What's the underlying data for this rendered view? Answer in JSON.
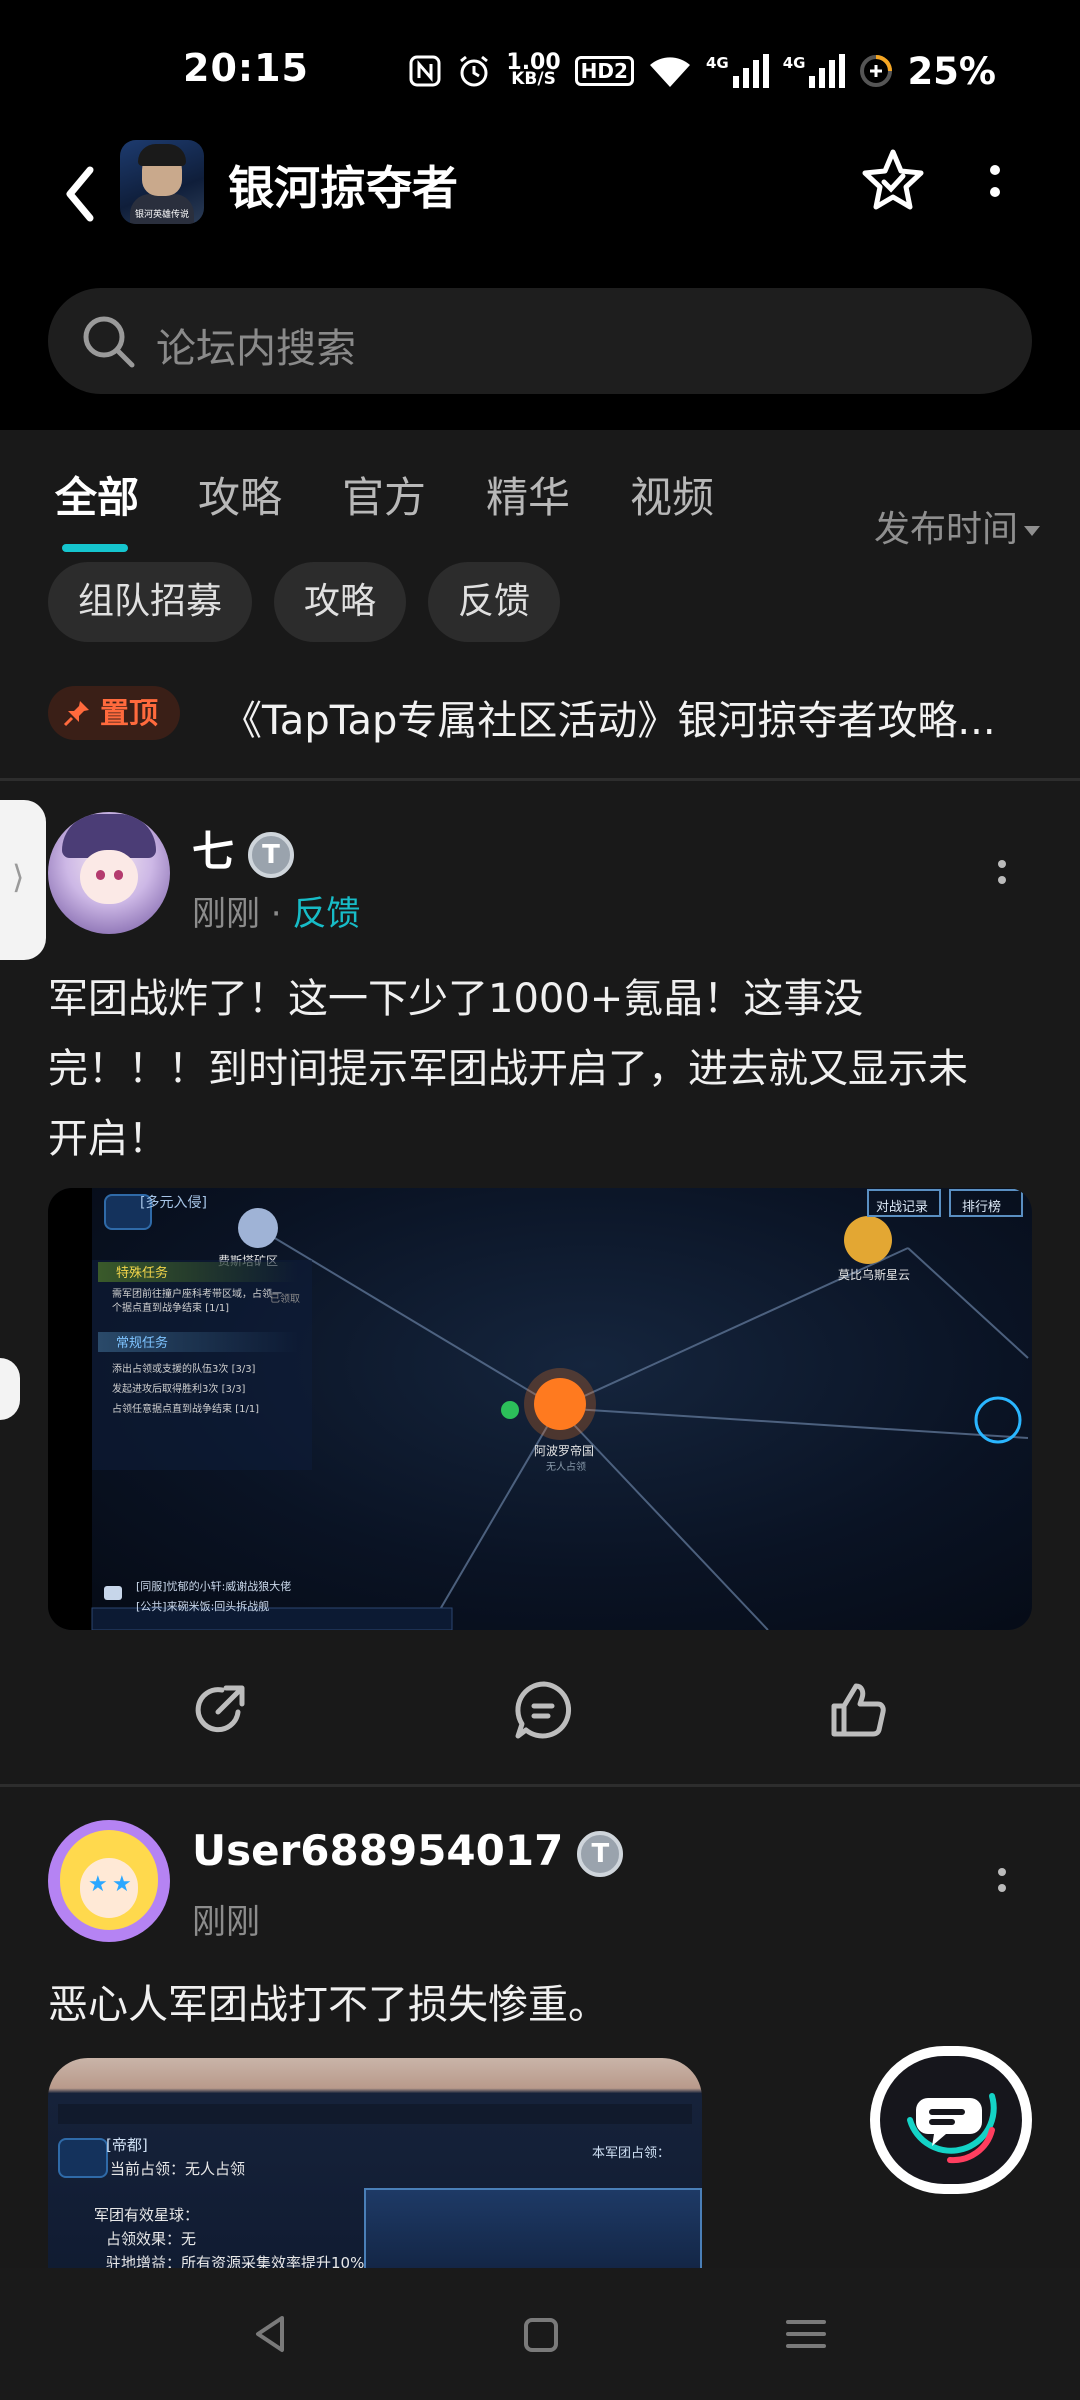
{
  "status_bar": {
    "time": "20:15",
    "net_speed_value": "1.00",
    "net_speed_unit": "KB/S",
    "hd_label": "HD2",
    "signal1": "4G",
    "signal2": "4G",
    "battery": "25%"
  },
  "header": {
    "title": "银河掠夺者",
    "app_icon_caption": "银河英雄传说"
  },
  "search": {
    "placeholder": "论坛内搜索"
  },
  "tabs": [
    {
      "label": "全部",
      "active": true
    },
    {
      "label": "攻略",
      "active": false
    },
    {
      "label": "官方",
      "active": false
    },
    {
      "label": "精华",
      "active": false
    },
    {
      "label": "视频",
      "active": false
    }
  ],
  "sort_label": "发布时间",
  "chips": [
    "组队招募",
    "攻略",
    "反馈"
  ],
  "pinned": {
    "badge": "置顶",
    "title": "《TapTap专属社区活动》银河掠夺者攻略..."
  },
  "posts": [
    {
      "username": "七",
      "badge": "T",
      "time": "刚刚",
      "category": "反馈",
      "text_line1": "军团战炸了！这一下少了1000+氪晶！这事没",
      "text_line2": "完！！！到时间提示军团战开启了，进去就又显示未",
      "text_line3": "开启！",
      "screenshot": {
        "mode": "[多元入侵]",
        "btn_records": "对战记录",
        "btn_rank": "排行榜",
        "planet1": "费斯塔矿区",
        "planet2": "莫比乌斯星云",
        "planet3": "阿波罗帝国",
        "planet_sub": "无人占领",
        "section1": "特殊任务",
        "task1": "需军团前往撞户座科考带区域，占领一个据点直到战争结束",
        "task1_progress": "[1/1]",
        "section2": "常规任务",
        "task2": "添出占领或支援的队伍3次",
        "task2_progress": "[3/3]",
        "task3": "发起进攻后取得胜利3次",
        "task3_progress": "[3/3]",
        "task4": "占领任意据点直到战争结束",
        "task4_progress": "[1/1]",
        "claimed": "已领取",
        "chat1": "[同服]忧郁的小轩:威谢战狼大佬",
        "chat2": "[公共]来碗米饭:回头拆战舰"
      }
    },
    {
      "username": "User688954017",
      "badge": "T",
      "time": "刚刚",
      "text_line1": "恶心人军团战打不了损失惨重。",
      "screenshot": {
        "location": "[帝都]",
        "occupy": "当前占领：无人占领",
        "legion_label": "本军团占领：",
        "effect_label": "军团有效星球：",
        "effect_value": "占领效果：无",
        "bonus": "驻地增益：所有资源采集效率提升10%"
      }
    }
  ],
  "colors": {
    "accent": "#15c5ce",
    "pin": "#ff6a3d",
    "background": "#191919"
  }
}
